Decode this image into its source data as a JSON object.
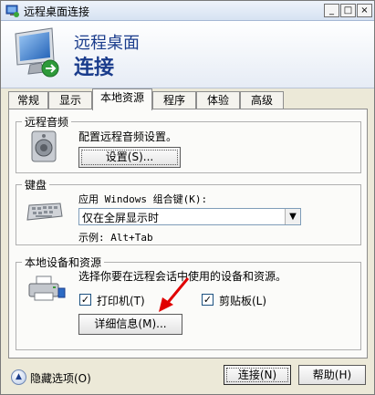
{
  "window": {
    "title": "远程桌面连接",
    "controls": {
      "minimize": "_",
      "maximize": "□",
      "close": "×"
    }
  },
  "banner": {
    "line1": "远程桌面",
    "line2": "连接"
  },
  "tabs": [
    {
      "label": "常规"
    },
    {
      "label": "显示"
    },
    {
      "label": "本地资源",
      "active": true
    },
    {
      "label": "程序"
    },
    {
      "label": "体验"
    },
    {
      "label": "高级"
    }
  ],
  "audio": {
    "group_title": "远程音频",
    "description": "配置远程音频设置。",
    "settings_button": "设置(S)..."
  },
  "keyboard": {
    "group_title": "键盘",
    "prompt": "应用 Windows 组合键(K):",
    "selected": "仅在全屏显示时",
    "example": "示例: Alt+Tab"
  },
  "devices": {
    "group_title": "本地设备和资源",
    "description": "选择你要在远程会话中使用的设备和资源。",
    "printers_label": "打印机(T)",
    "printers_checked": true,
    "clipboard_label": "剪贴板(L)",
    "clipboard_checked": true,
    "details_button": "详细信息(M)..."
  },
  "footer": {
    "hide_options": "隐藏选项(O)",
    "connect_button": "连接(N)",
    "help_button": "帮助(H)"
  },
  "colors": {
    "window_bg": "#ece9d8",
    "panel_bg": "#fbfbf9",
    "banner_text": "#1a3c8c",
    "annotation_arrow": "#e00000"
  },
  "icons": {
    "app": "remote-desktop-icon",
    "audio": "speaker-icon",
    "keyboard": "keyboard-icon",
    "devices": "printer-icon",
    "arrow": "red-arrow-annotation",
    "hide_options": "chevron-up-icon"
  }
}
